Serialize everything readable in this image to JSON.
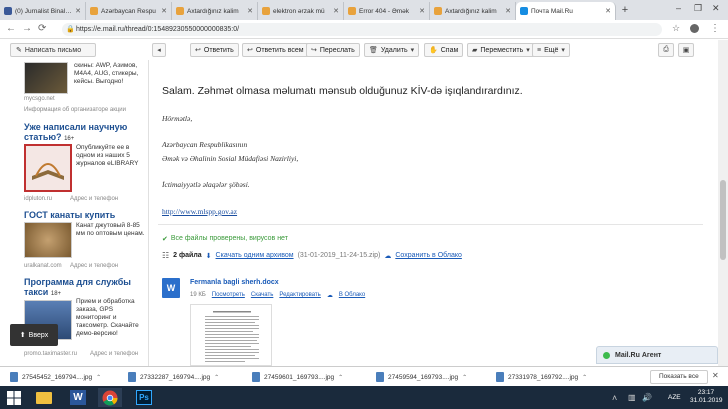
{
  "browser": {
    "tabs": [
      {
        "title": "(0) Jurnalist Binaları",
        "color": "#3b5998"
      },
      {
        "title": "Azərbaycan Respu",
        "color": "#e8a23c"
      },
      {
        "title": "Axtardığınız kalim",
        "color": "#e8a23c"
      },
      {
        "title": "elektron ərzak mü",
        "color": "#e8a23c"
      },
      {
        "title": "Error 404 - Əmək",
        "color": "#e8a23c"
      },
      {
        "title": "Axtardığınız kalim",
        "color": "#e8a23c"
      },
      {
        "title": "Почта Mail.Ru",
        "color": "#168de2"
      }
    ],
    "url": "https://e.mail.ru/thread/0:15489230550000000835:0/"
  },
  "toolbar": {
    "compose_label": "Написать письмо",
    "reply": "Ответить",
    "reply_all": "Ответить всем",
    "forward": "Переслать",
    "delete": "Удалить",
    "spam": "Спам",
    "move": "Переместить",
    "more": "Ещё"
  },
  "ads": {
    "ad1_text": "скины: AWP, Азимов, M4A4, AUG, стикеры, кейсы. Выгодно!",
    "ad1_source": "mycsgo.net",
    "ad1_sub": "Информация об организаторе акции",
    "ad2_head": "Уже написали научную статью?",
    "ad2_badge": "16+",
    "ad2_text": "Опубликуйте ее в одном из наших 5 журналов eLIBRARY",
    "ad2_source": "idpluton.ru",
    "ad2_link": "Адрес и телефон",
    "ad3_head": "ГОСТ канаты купить",
    "ad3_text": "Канат джутовый 8-85 мм по оптовым ценам.",
    "ad3_source": "uralkanat.com",
    "ad3_link": "Адрес и телефон",
    "ad4_head": "Программа для службы такси",
    "ad4_badge": "18+",
    "ad4_text": "Прием и обработка заказа, GPS мониторинг и таксометр. Скачайте демо-версию!",
    "ad4_source": "promo.taximaster.ru",
    "ad4_link": "Адрес и телефон",
    "up_label": "Вверх"
  },
  "message": {
    "greeting": "Salam. Zəhmət olmasa məlumatı mənsub olduğunuz KİV-də işıqlandırardınız.",
    "regards": "Hörmətlə,",
    "org_line1": "Azərbaycan Respublikasının",
    "org_line2": "Əmək və Əhalinin Sosial Müdafiəsi Nazirliyi,",
    "dept": "İctimaiyyətlə əlaqələr şöbəsi.",
    "link": "http://www.mlspp.gov.az",
    "virus_check": "Все файлы проверены, вирусов нет",
    "files_count": "2 файла",
    "download_archive": "Скачать одним архивом",
    "archive_name": "(31-01-2019_11-24-15.zip)",
    "save_cloud": "Сохранить в Облако",
    "file_name": "Fermanla bagli sherh.docx",
    "file_size": "19 КБ",
    "file_actions": [
      "Посмотреть",
      "Скачать",
      "Редактировать",
      "В Облако"
    ]
  },
  "agent": {
    "label": "Mail.Ru Агент"
  },
  "downloads": {
    "items": [
      "27545452_169794....jpg",
      "27332287_169794....jpg",
      "27459601_169793....jpg",
      "27459594_169793....jpg",
      "27331978_169792....jpg"
    ],
    "show_all": "Показать все"
  },
  "taskbar": {
    "lang": "AZE",
    "time": "23:17",
    "date": "31.01.2019"
  }
}
